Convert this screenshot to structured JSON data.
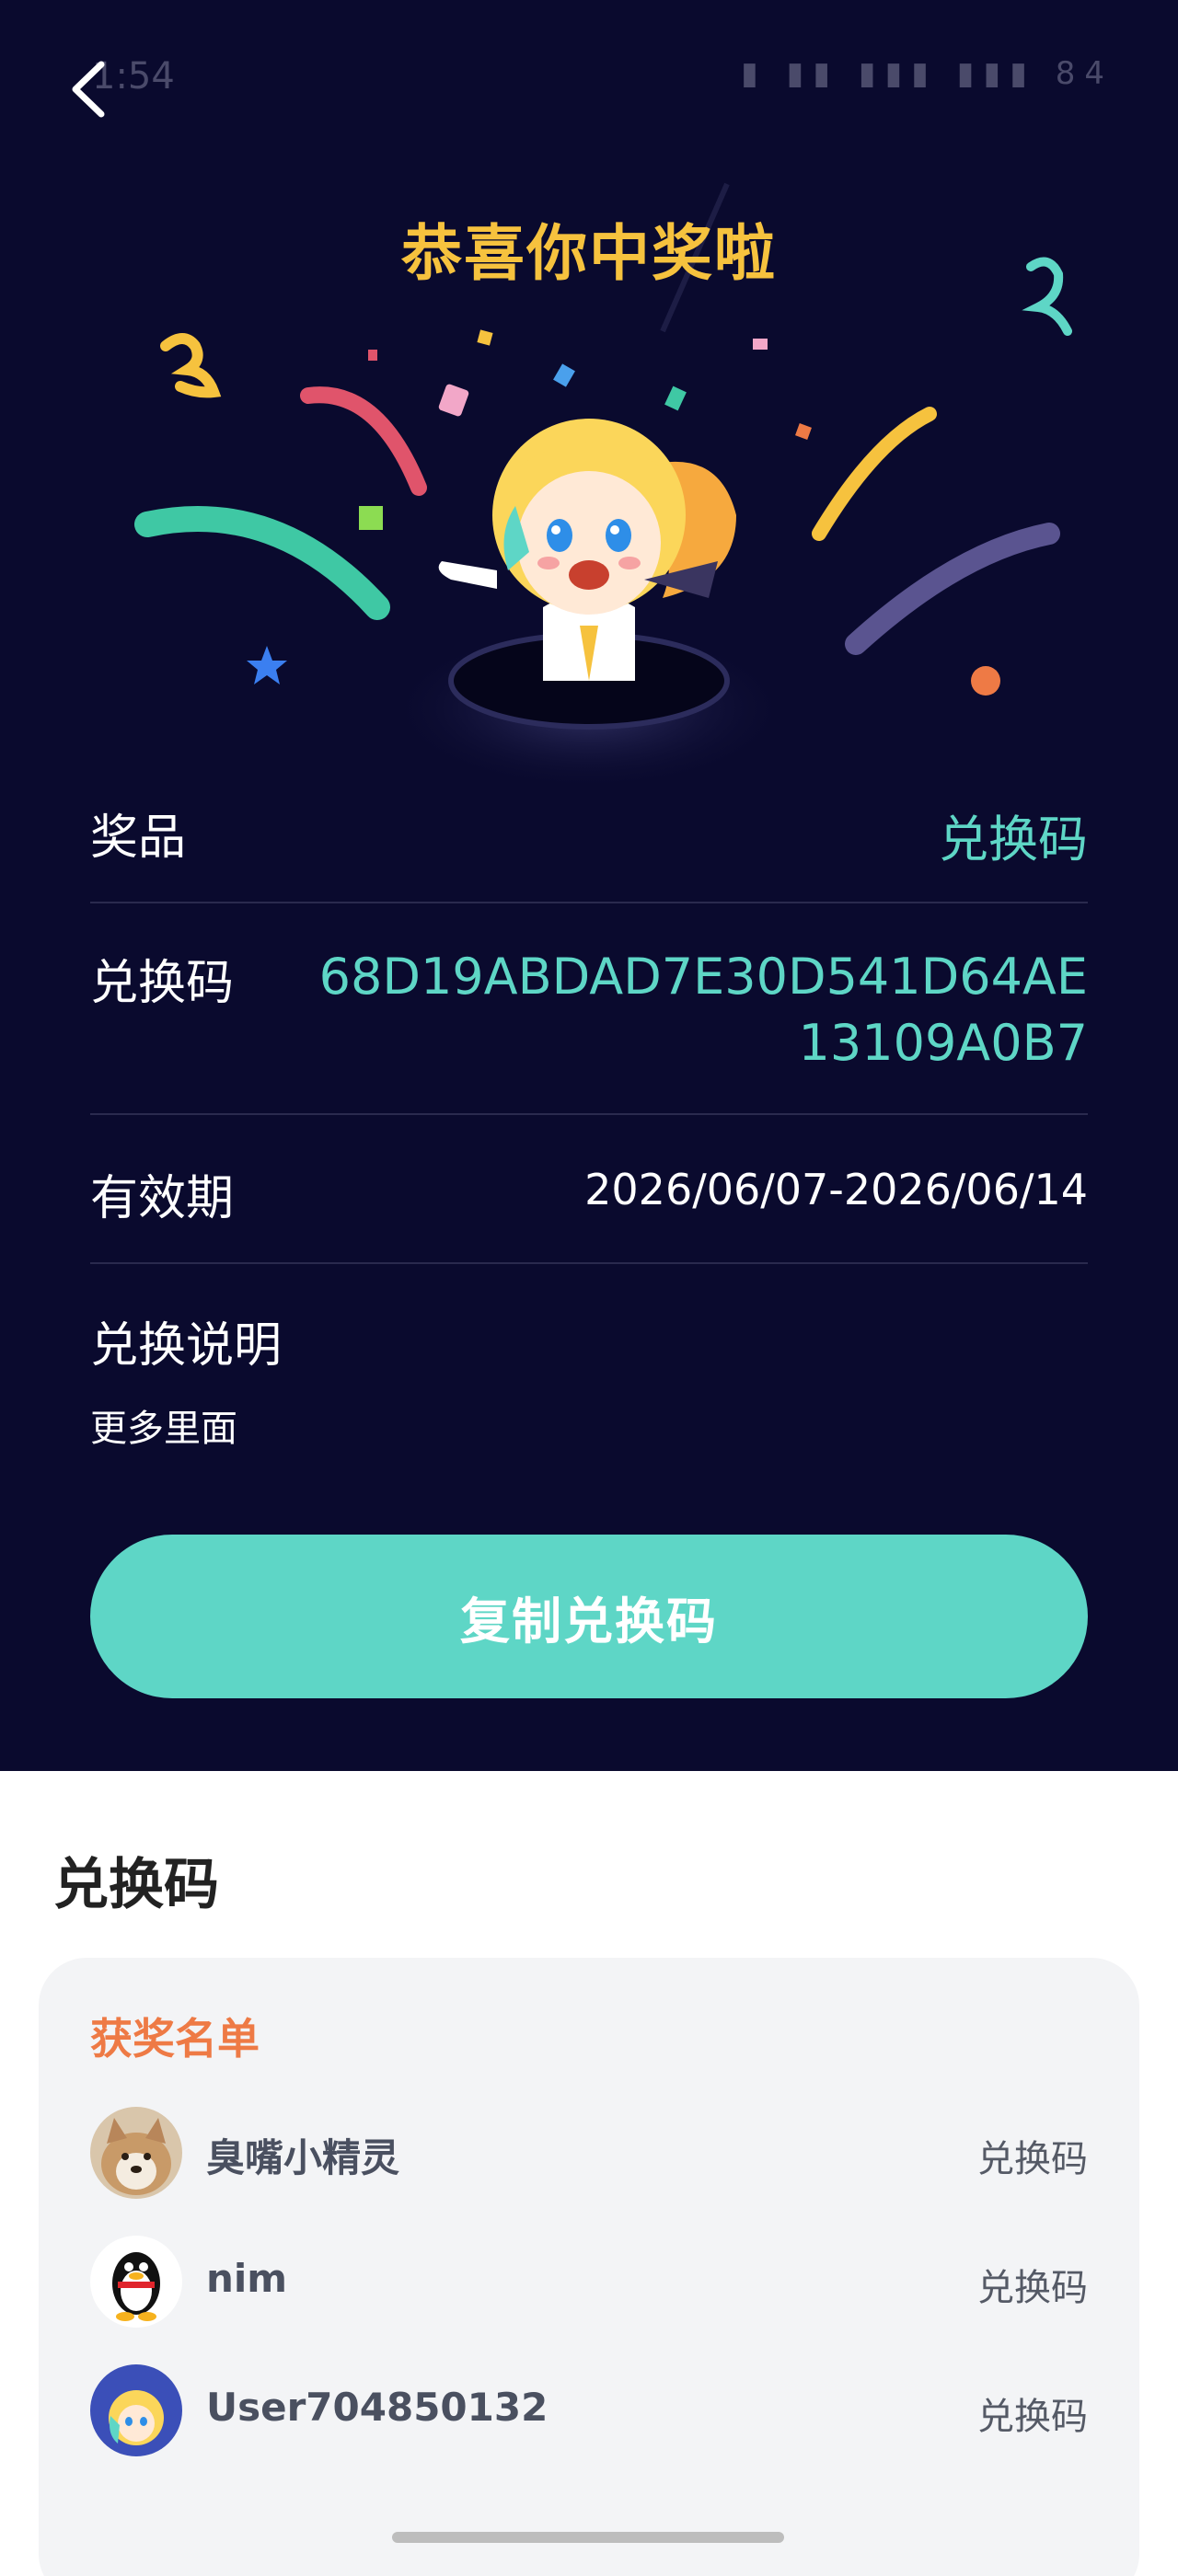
{
  "status": {
    "time": "1:54",
    "battery": "84"
  },
  "header": {
    "headline": "恭喜你中奖啦"
  },
  "details": {
    "prize_label": "奖品",
    "prize_value": "兑换码",
    "code_label": "兑换码",
    "code_line1": "68D19ABDAD7E30D541D64AE",
    "code_line2": "13109A0B7",
    "valid_label": "有效期",
    "valid_value": "2026/06/07-2026/06/14",
    "instructions_label": "兑换说明",
    "instructions_text": "更多里面"
  },
  "actions": {
    "copy_label": "复制兑换码"
  },
  "section": {
    "title": "兑换码"
  },
  "winners": {
    "title": "获奖名单",
    "items": [
      {
        "name": "臭嘴小精灵",
        "prize": "兑换码",
        "avatar_icon": "shiba-dog-avatar"
      },
      {
        "name": "nim",
        "prize": "兑换码",
        "avatar_icon": "qq-penguin-avatar"
      },
      {
        "name": "User704850132",
        "prize": "兑换码",
        "avatar_icon": "mascot-avatar"
      }
    ]
  },
  "colors": {
    "background": "#0a0a2e",
    "accent": "#5ed6c6",
    "headline": "#f6c23e",
    "winners_title": "#ee7a45"
  }
}
